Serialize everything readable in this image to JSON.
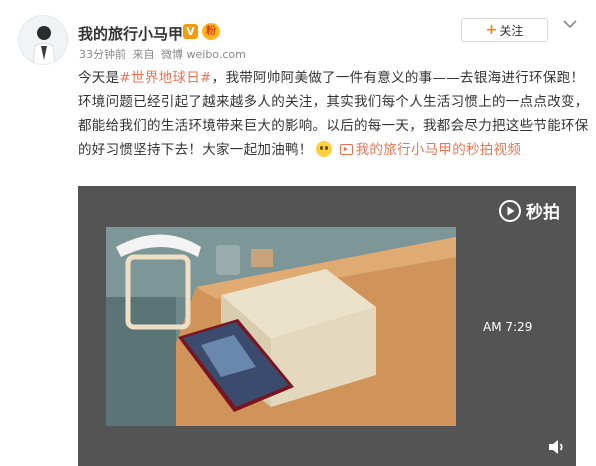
{
  "author": {
    "name": "我的旅行小马甲",
    "verified_mark": "V",
    "fan_badge": "粉"
  },
  "meta": {
    "time": "33分钟前",
    "source_prefix": "来自",
    "source": "微博 weibo.com"
  },
  "actions": {
    "follow_label": "关注"
  },
  "post": {
    "p1": "今天是",
    "topic": "#世界地球日#",
    "p2": "，我带阿帅阿美做了一件有意义的事——去银海进行环保跑！环境问题已经引起了越来越多人的关注，其实我们每个人生活习惯上的一点点改变，都能给我们的生活环境带来巨大的影响。以后的每一天，我都会尽力把这些节能环保的好习惯坚持下去！大家一起加油鸭！",
    "video_link": "我的旅行小马甲的秒拍视频"
  },
  "video": {
    "brand": "秒拍",
    "phone_time": "AM 7:29"
  },
  "colors": {
    "accent": "#eb7350",
    "follow_plus": "#ff8200",
    "player_bg": "#545454"
  },
  "icons": [
    "avatar",
    "verified-badge",
    "fan-badge",
    "chevron-down-icon",
    "emoji-icon",
    "video-link-icon",
    "miaopai-logo-icon",
    "volume-icon"
  ]
}
